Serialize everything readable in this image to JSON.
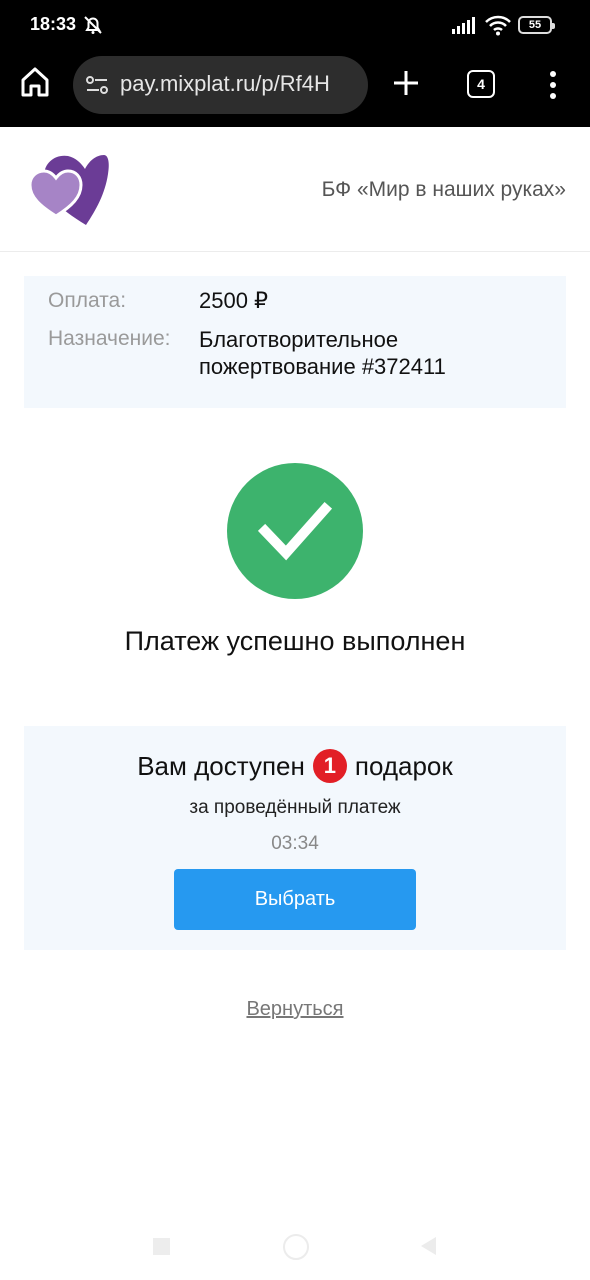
{
  "status_bar": {
    "time": "18:33",
    "battery": "55"
  },
  "browser": {
    "url": "pay.mixplat.ru/p/Rf4H",
    "tab_count": "4"
  },
  "site": {
    "org_name": "БФ «Мир в наших руках»"
  },
  "receipt": {
    "amount_label": "Оплата:",
    "amount_value": "2500 ₽",
    "purpose_label": "Назначение:",
    "purpose_line1": "Благотворительное",
    "purpose_line2": "пожертвование #372411"
  },
  "success": {
    "title": "Платеж успешно выполнен"
  },
  "gift": {
    "prefix": "Вам доступен",
    "count": "1",
    "suffix": "подарок",
    "subtitle": "за проведённый платеж",
    "timer": "03:34",
    "button_label": "Выбрать"
  },
  "back_link": "Вернуться",
  "colors": {
    "success": "#3db36d",
    "button": "#2699f0",
    "badge": "#e21f26",
    "brand": "#7d3f98"
  }
}
